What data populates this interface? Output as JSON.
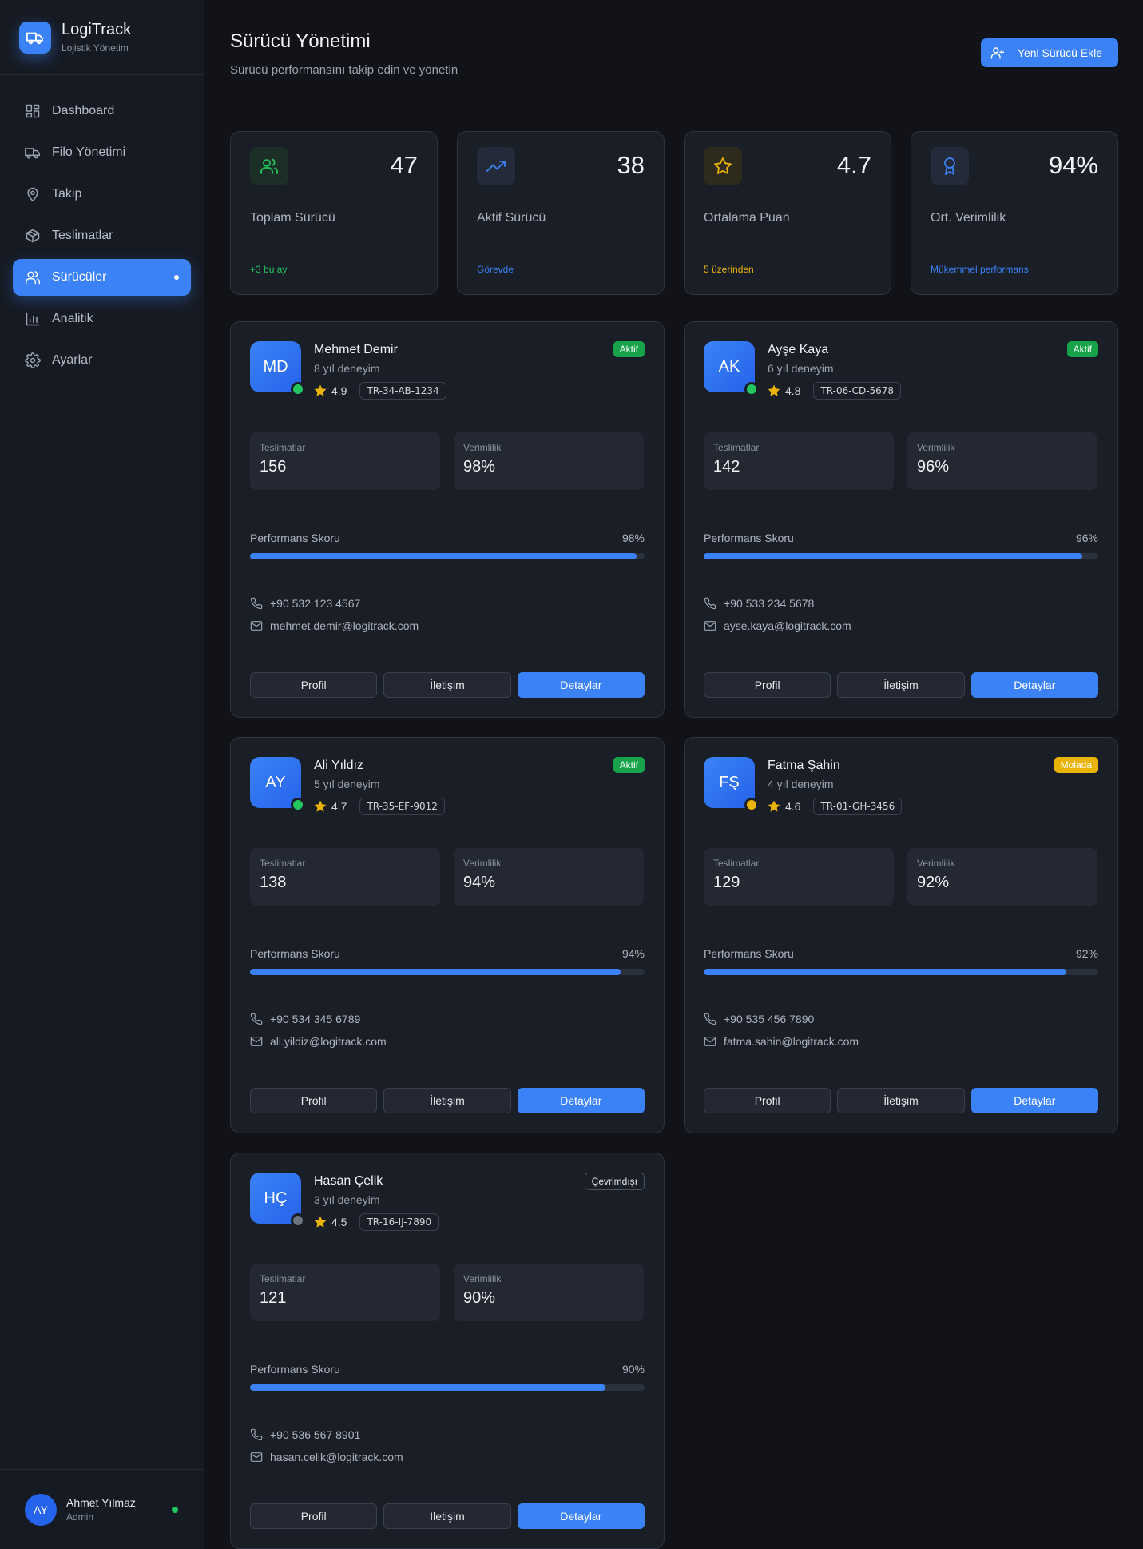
{
  "brand": {
    "title": "LogiTrack",
    "subtitle": "Lojistik Yönetim"
  },
  "nav": [
    {
      "label": "Dashboard",
      "icon": "dashboard-icon",
      "active": false
    },
    {
      "label": "Filo Yönetimi",
      "icon": "truck-icon",
      "active": false
    },
    {
      "label": "Takip",
      "icon": "map-pin-icon",
      "active": false
    },
    {
      "label": "Teslimatlar",
      "icon": "package-icon",
      "active": false
    },
    {
      "label": "Sürücüler",
      "icon": "users-icon",
      "active": true
    },
    {
      "label": "Analitik",
      "icon": "bar-chart-icon",
      "active": false
    },
    {
      "label": "Ayarlar",
      "icon": "gear-icon",
      "active": false
    }
  ],
  "user": {
    "initials": "AY",
    "name": "Ahmet Yılmaz",
    "role": "Admin"
  },
  "header": {
    "title": "Sürücü Yönetimi",
    "subtitle": "Sürücü performansını takip edin ve yönetin",
    "add_button": "Yeni Sürücü Ekle"
  },
  "stats": [
    {
      "value": "47",
      "label": "Toplam Sürücü",
      "note": "+3 bu ay",
      "icon": "users-icon",
      "color": "#22c55e",
      "bg": "#1c2f26"
    },
    {
      "value": "38",
      "label": "Aktif Sürücü",
      "note": "Görevde",
      "icon": "trending-up-icon",
      "color": "#3b82f6",
      "bg": "#232a3a"
    },
    {
      "value": "4.7",
      "label": "Ortalama Puan",
      "note": "5 üzerinden",
      "icon": "star-icon",
      "color": "#eab308",
      "bg": "#2e2a1c"
    },
    {
      "value": "94%",
      "label": "Ort. Verimlilik",
      "note": "Mükemmel performans",
      "icon": "award-icon",
      "color": "#3b82f6",
      "bg": "#232a3a"
    }
  ],
  "drivers": [
    {
      "initials": "MD",
      "name": "Mehmet Demir",
      "experience": "8 yıl deneyim",
      "rating": "4.9",
      "plate": "TR-34-AB-1234",
      "status": "Aktif",
      "status_color": "#22c55e",
      "status_bg": "#16a34a",
      "status_fg": "#ffffff",
      "deliveries": "156",
      "efficiency": "98%",
      "performance": "98%",
      "performance_value": 98,
      "phone": "+90 532 123 4567",
      "email": "mehmet.demir@logitrack.com"
    },
    {
      "initials": "AK",
      "name": "Ayşe Kaya",
      "experience": "6 yıl deneyim",
      "rating": "4.8",
      "plate": "TR-06-CD-5678",
      "status": "Aktif",
      "status_color": "#22c55e",
      "status_bg": "#16a34a",
      "status_fg": "#ffffff",
      "deliveries": "142",
      "efficiency": "96%",
      "performance": "96%",
      "performance_value": 96,
      "phone": "+90 533 234 5678",
      "email": "ayse.kaya@logitrack.com"
    },
    {
      "initials": "AY",
      "name": "Ali Yıldız",
      "experience": "5 yıl deneyim",
      "rating": "4.7",
      "plate": "TR-35-EF-9012",
      "status": "Aktif",
      "status_color": "#22c55e",
      "status_bg": "#16a34a",
      "status_fg": "#ffffff",
      "deliveries": "138",
      "efficiency": "94%",
      "performance": "94%",
      "performance_value": 94,
      "phone": "+90 534 345 6789",
      "email": "ali.yildiz@logitrack.com"
    },
    {
      "initials": "FŞ",
      "name": "Fatma Şahin",
      "experience": "4 yıl deneyim",
      "rating": "4.6",
      "plate": "TR-01-GH-3456",
      "status": "Molada",
      "status_color": "#eab308",
      "status_bg": "#eab308",
      "status_fg": "#ffffff",
      "deliveries": "129",
      "efficiency": "92%",
      "performance": "92%",
      "performance_value": 92,
      "phone": "+90 535 456 7890",
      "email": "fatma.sahin@logitrack.com"
    },
    {
      "initials": "HÇ",
      "name": "Hasan Çelik",
      "experience": "3 yıl deneyim",
      "rating": "4.5",
      "plate": "TR-16-IJ-7890",
      "status": "Çevrimdışı",
      "status_color": "#6b7280",
      "status_bg": "transparent",
      "status_fg": "#e5e7eb",
      "deliveries": "121",
      "efficiency": "90%",
      "performance": "90%",
      "performance_value": 90,
      "phone": "+90 536 567 8901",
      "email": "hasan.celik@logitrack.com"
    }
  ],
  "labels": {
    "deliveries": "Teslimatlar",
    "efficiency": "Verimlilik",
    "performance": "Performans Skoru",
    "profile_btn": "Profil",
    "contact_btn": "İletişim",
    "details_btn": "Detaylar"
  }
}
